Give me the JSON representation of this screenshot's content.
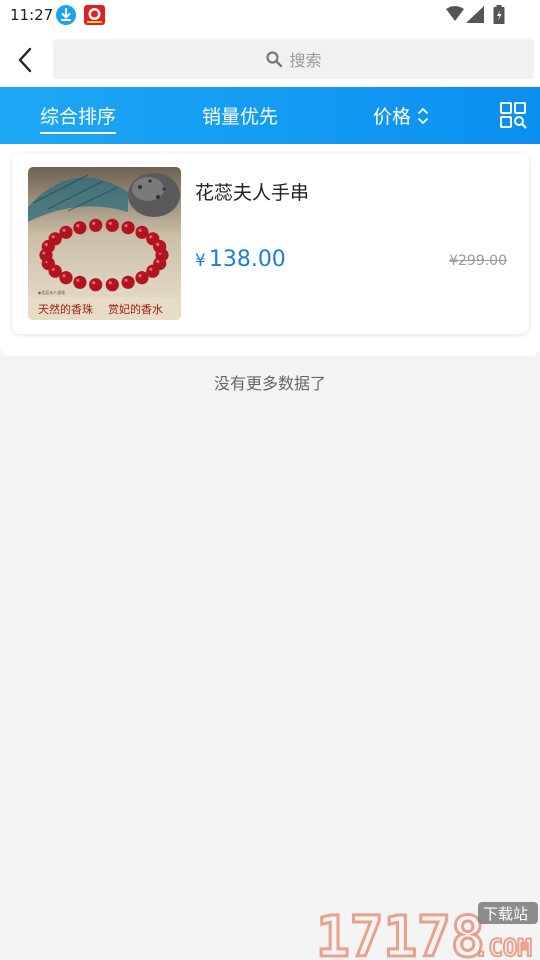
{
  "status": {
    "time": "11:27"
  },
  "search": {
    "placeholder": "搜索"
  },
  "tabs": {
    "comprehensive": "综合排序",
    "sales": "销量优先",
    "price": "价格"
  },
  "product": {
    "name": "花蕊夫人手串",
    "currency": "¥",
    "price": "138.00",
    "original_price": "¥299.00",
    "image_caption_left": "天然的香珠",
    "image_caption_right": "赏妃的香水"
  },
  "list": {
    "no_more_text": "没有更多数据了"
  },
  "watermark": {
    "number": "17178",
    "badge": "下载站",
    "domain": ".COM"
  },
  "colors": {
    "accent": "#1a7fe0",
    "tab_bar": "#1ea8f5",
    "bead": "#b3121f"
  }
}
